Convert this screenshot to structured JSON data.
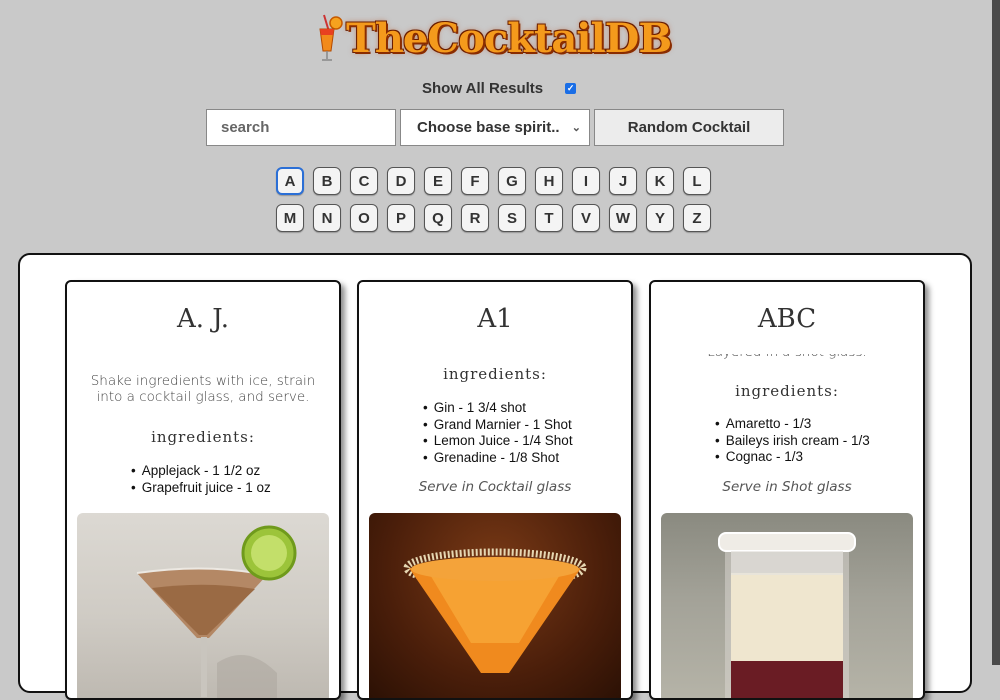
{
  "header": {
    "brand": "TheCocktailDB",
    "show_all_label": "Show All Results",
    "show_all_checked": true
  },
  "search": {
    "placeholder": "search",
    "value": ""
  },
  "spirit_select": {
    "selected": "Choose base spirit.."
  },
  "random_button": {
    "label": "Random Cocktail"
  },
  "letters": {
    "row1": [
      "A",
      "B",
      "C",
      "D",
      "E",
      "F",
      "G",
      "H",
      "I",
      "J",
      "K",
      "L"
    ],
    "row2": [
      "M",
      "N",
      "O",
      "P",
      "Q",
      "R",
      "S",
      "T",
      "V",
      "W",
      "Y",
      "Z"
    ],
    "active": "A"
  },
  "cards": [
    {
      "name": "A. J.",
      "instructions": "Shake ingredients with ice, strain into a cocktail glass, and serve.",
      "ingredients_heading": "ingredients:",
      "ingredients": [
        "Applejack - 1 1/2 oz",
        "Grapefruit juice - 1 oz"
      ],
      "serve": ""
    },
    {
      "name": "A1",
      "instructions": "",
      "ingredients_heading": "ingredients:",
      "ingredients": [
        "Gin - 1 3/4 shot",
        "Grand Marnier - 1 Shot",
        "Lemon Juice - 1/4 Shot",
        "Grenadine - 1/8 Shot"
      ],
      "serve": "Serve in Cocktail glass"
    },
    {
      "name": "ABC",
      "instructions": "Layered in a shot glass.",
      "ingredients_heading": "ingredients:",
      "ingredients": [
        "Amaretto - 1/3",
        "Baileys irish cream - 1/3",
        "Cognac - 1/3"
      ],
      "serve": "Serve in Shot glass"
    }
  ],
  "colors": {
    "background": "#c9c9c9",
    "brand_orange": "#f49a1c",
    "checkbox_blue": "#1a6ee6",
    "active_letter_border": "#2b6fd6"
  }
}
